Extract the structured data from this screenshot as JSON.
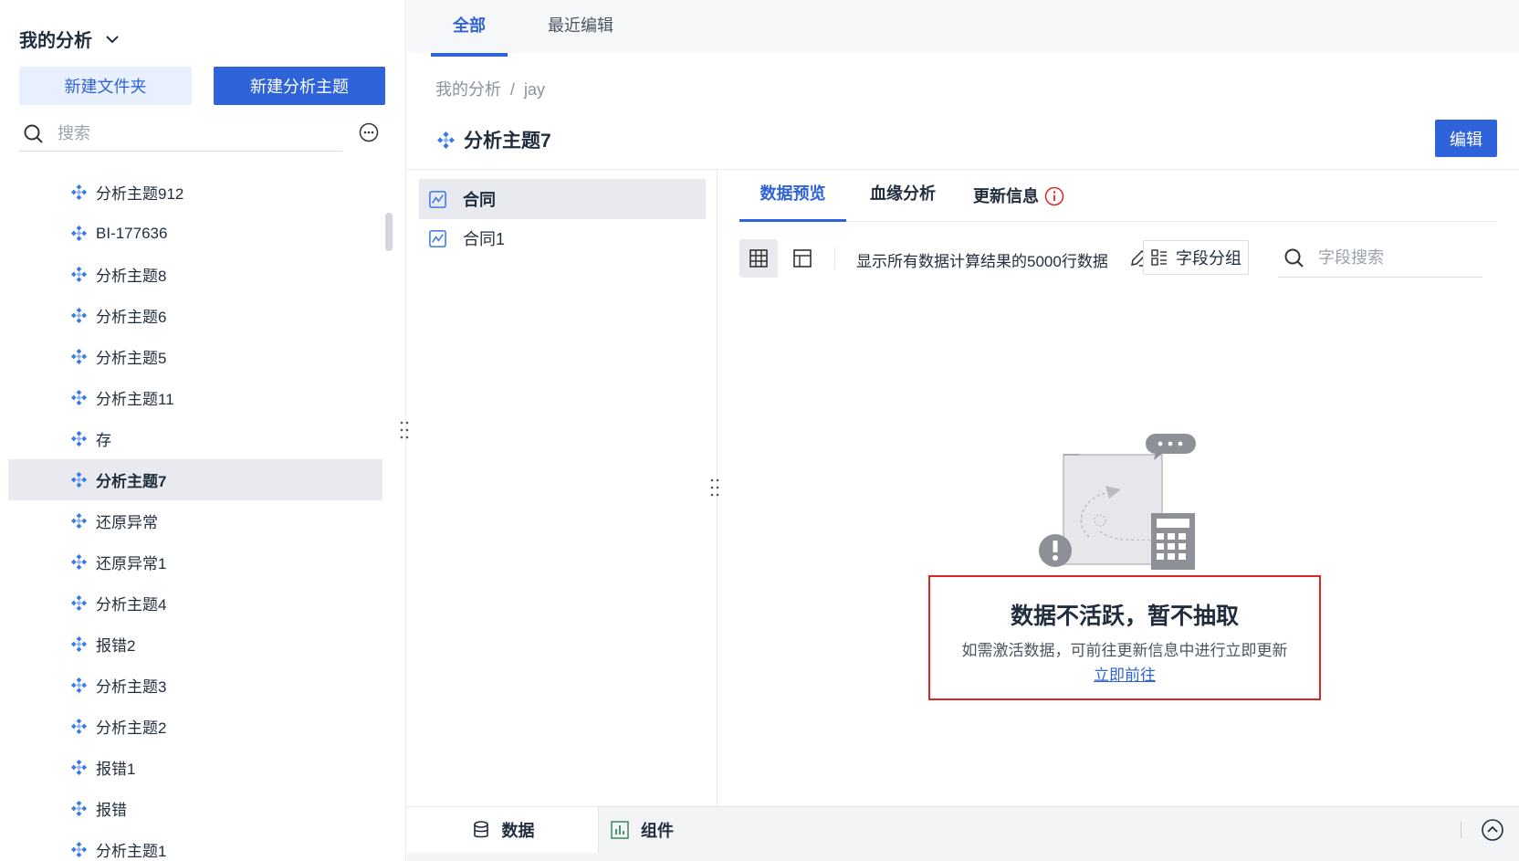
{
  "sidebar": {
    "title": "我的分析",
    "new_folder_label": "新建文件夹",
    "new_theme_label": "新建分析主题",
    "search_placeholder": "搜索",
    "items": [
      {
        "label": "分析主题912",
        "active": false
      },
      {
        "label": "BI-177636",
        "active": false
      },
      {
        "label": "分析主题8",
        "active": false
      },
      {
        "label": "分析主题6",
        "active": false
      },
      {
        "label": "分析主题5",
        "active": false
      },
      {
        "label": "分析主题11",
        "active": false
      },
      {
        "label": "存",
        "active": false
      },
      {
        "label": "分析主题7",
        "active": true
      },
      {
        "label": "还原异常",
        "active": false
      },
      {
        "label": "还原异常1",
        "active": false
      },
      {
        "label": "分析主题4",
        "active": false
      },
      {
        "label": "报错2",
        "active": false
      },
      {
        "label": "分析主题3",
        "active": false
      },
      {
        "label": "分析主题2",
        "active": false
      },
      {
        "label": "报错1",
        "active": false
      },
      {
        "label": "报错",
        "active": false
      },
      {
        "label": "分析主题1",
        "active": false
      }
    ]
  },
  "top_tabs": {
    "all": "全部",
    "recent": "最近编辑"
  },
  "breadcrumb": {
    "root": "我的分析",
    "separator": "/",
    "current": "jay"
  },
  "header": {
    "title": "分析主题7",
    "edit_label": "编辑"
  },
  "tables": [
    {
      "label": "合同",
      "active": true
    },
    {
      "label": "合同1",
      "active": false
    }
  ],
  "detail_tabs": {
    "preview": "数据预览",
    "lineage": "血缘分析",
    "update": "更新信息"
  },
  "toolbar": {
    "rows_text": "显示所有数据计算结果的5000行数据",
    "field_group_label": "字段分组",
    "field_search_placeholder": "字段搜索"
  },
  "empty_state": {
    "title": "数据不活跃，暂不抽取",
    "description": "如需激活数据，可前往更新信息中进行立即更新",
    "link": "立即前往"
  },
  "bottom_tabs": {
    "data": "数据",
    "widget": "组件"
  },
  "colors": {
    "accent": "#2f63d9",
    "warning": "#e02424",
    "icon_blue": "#3a78e8"
  }
}
